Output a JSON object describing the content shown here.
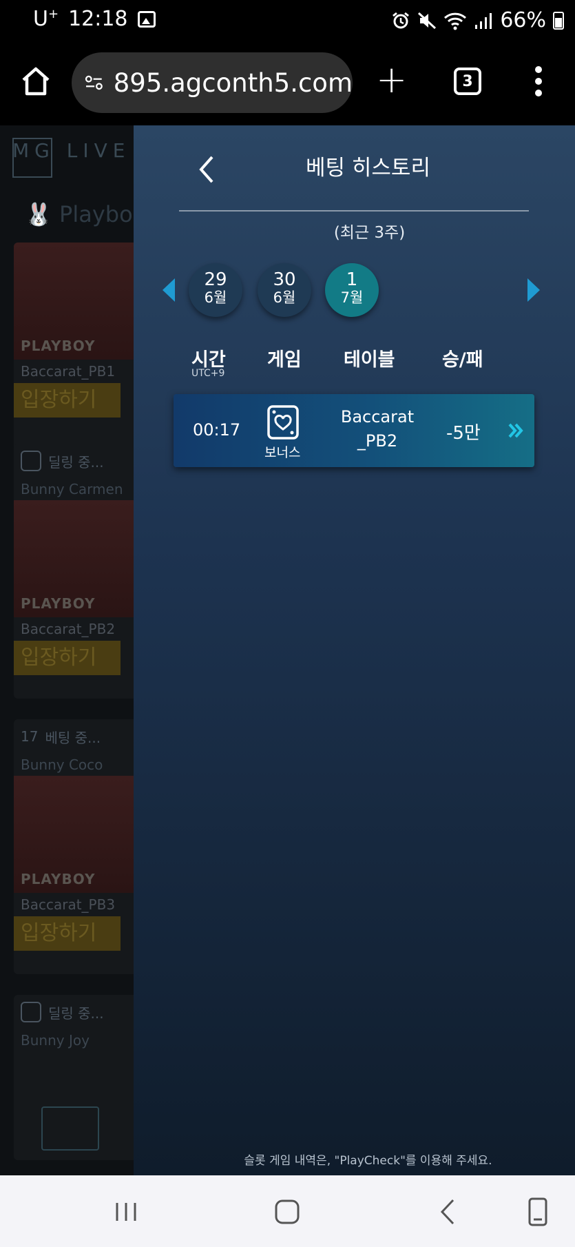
{
  "status_bar": {
    "carrier": "U",
    "carrier_sup": "+",
    "time": "12:18",
    "battery": "66%"
  },
  "browser": {
    "url": "895.agconth5.com",
    "tab_count": "3"
  },
  "background_page": {
    "logo": "MG LIVE",
    "category": "Playbo",
    "cards": [
      {
        "status": "",
        "host": "",
        "brand": "PLAYBOY",
        "table": "Baccarat_PB1",
        "enter": "입장하기"
      },
      {
        "status": "딜링 중...",
        "host": "Bunny Carmen",
        "brand": "PLAYBOY",
        "table": "Baccarat_PB2",
        "enter": "입장하기"
      },
      {
        "status": "베팅 중...",
        "status_count": "17",
        "host": "Bunny Coco",
        "brand": "PLAYBOY",
        "table": "Baccarat_PB3",
        "enter": "입장하기"
      },
      {
        "status": "딜링 중...",
        "host": "Bunny Joy",
        "brand": "",
        "table": "",
        "enter": ""
      }
    ]
  },
  "panel": {
    "title": "베팅 히스토리",
    "period": "(최근 3주)",
    "dates": [
      {
        "day": "29",
        "month": "6월",
        "active": false
      },
      {
        "day": "30",
        "month": "6월",
        "active": false
      },
      {
        "day": "1",
        "month": "7월",
        "active": true
      }
    ],
    "columns": {
      "time": "시간",
      "time_sub": "UTC+9",
      "game": "게임",
      "table": "테이블",
      "result": "승/패"
    },
    "rows": [
      {
        "time": "00:17",
        "game": "보너스",
        "table_line1": "Baccarat",
        "table_line2": "_PB2",
        "result": "-5만",
        "detail_icon": "double-chevron-right-icon"
      }
    ],
    "footer": "슬롯 게임 내역은, \"PlayCheck\"를 이용해 주세요."
  },
  "colors": {
    "accent": "#1f9bd2",
    "active_date": "#127b86",
    "detail": "#22c6e6"
  }
}
